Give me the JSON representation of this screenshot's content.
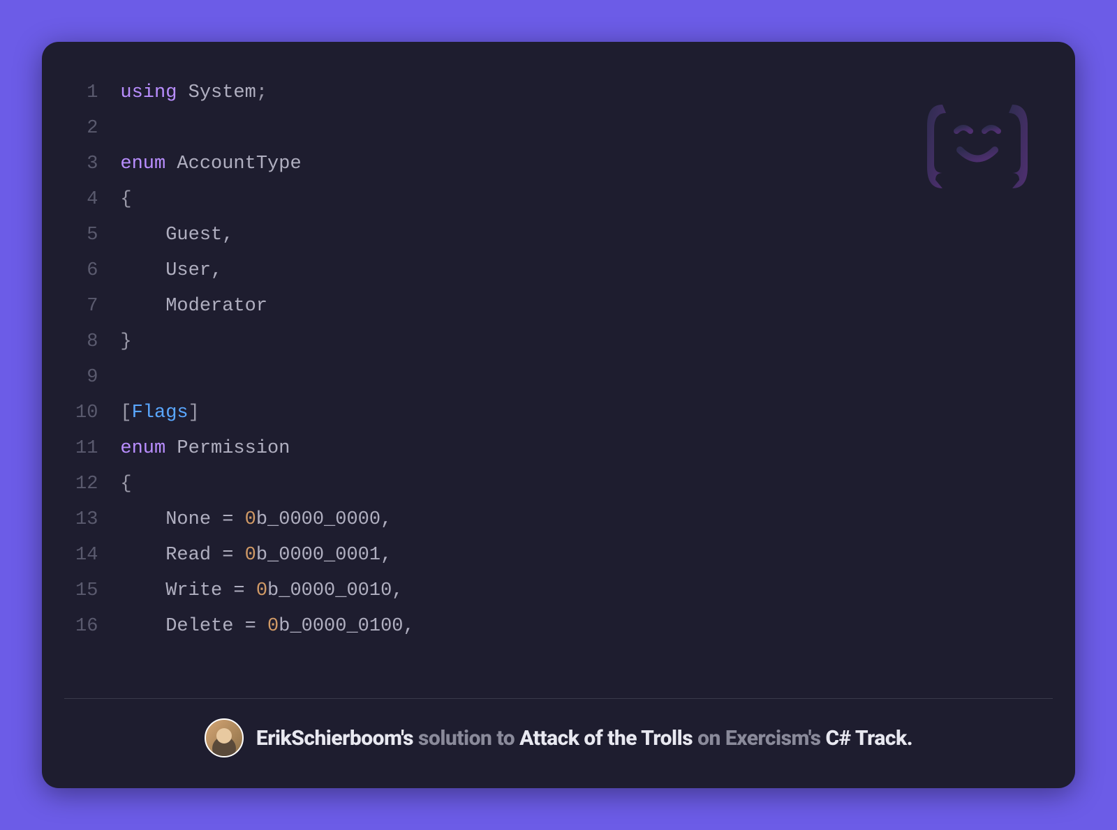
{
  "code": {
    "lines": [
      {
        "n": 1,
        "tokens": [
          {
            "t": "using",
            "c": "kw"
          },
          {
            "t": " ",
            "c": "txt"
          },
          {
            "t": "System",
            "c": "ident"
          },
          {
            "t": ";",
            "c": "txt"
          }
        ]
      },
      {
        "n": 2,
        "tokens": []
      },
      {
        "n": 3,
        "tokens": [
          {
            "t": "enum",
            "c": "kw"
          },
          {
            "t": " ",
            "c": "txt"
          },
          {
            "t": "AccountType",
            "c": "ident"
          }
        ]
      },
      {
        "n": 4,
        "tokens": [
          {
            "t": "{",
            "c": "txt"
          }
        ]
      },
      {
        "n": 5,
        "tokens": [
          {
            "t": "    Guest,",
            "c": "ident"
          }
        ]
      },
      {
        "n": 6,
        "tokens": [
          {
            "t": "    User,",
            "c": "ident"
          }
        ]
      },
      {
        "n": 7,
        "tokens": [
          {
            "t": "    Moderator",
            "c": "ident"
          }
        ]
      },
      {
        "n": 8,
        "tokens": [
          {
            "t": "}",
            "c": "txt"
          }
        ]
      },
      {
        "n": 9,
        "tokens": []
      },
      {
        "n": 10,
        "tokens": [
          {
            "t": "[",
            "c": "txt"
          },
          {
            "t": "Flags",
            "c": "cls"
          },
          {
            "t": "]",
            "c": "txt"
          }
        ]
      },
      {
        "n": 11,
        "tokens": [
          {
            "t": "enum",
            "c": "kw"
          },
          {
            "t": " ",
            "c": "txt"
          },
          {
            "t": "Permission",
            "c": "ident"
          }
        ]
      },
      {
        "n": 12,
        "tokens": [
          {
            "t": "{",
            "c": "txt"
          }
        ]
      },
      {
        "n": 13,
        "tokens": [
          {
            "t": "    None = ",
            "c": "ident"
          },
          {
            "t": "0",
            "c": "num"
          },
          {
            "t": "b_0000_0000,",
            "c": "ident"
          }
        ]
      },
      {
        "n": 14,
        "tokens": [
          {
            "t": "    Read = ",
            "c": "ident"
          },
          {
            "t": "0",
            "c": "num"
          },
          {
            "t": "b_0000_0001,",
            "c": "ident"
          }
        ]
      },
      {
        "n": 15,
        "tokens": [
          {
            "t": "    Write = ",
            "c": "ident"
          },
          {
            "t": "0",
            "c": "num"
          },
          {
            "t": "b_0000_0010,",
            "c": "ident"
          }
        ]
      },
      {
        "n": 16,
        "tokens": [
          {
            "t": "    Delete = ",
            "c": "ident"
          },
          {
            "t": "0",
            "c": "num"
          },
          {
            "t": "b_0000_0100,",
            "c": "ident"
          }
        ]
      }
    ]
  },
  "footer": {
    "author": "ErikSchierboom's",
    "mid1": " solution to ",
    "exercise": "Attack of the Trolls",
    "mid2": " on Exercism's ",
    "track": "C# Track."
  }
}
